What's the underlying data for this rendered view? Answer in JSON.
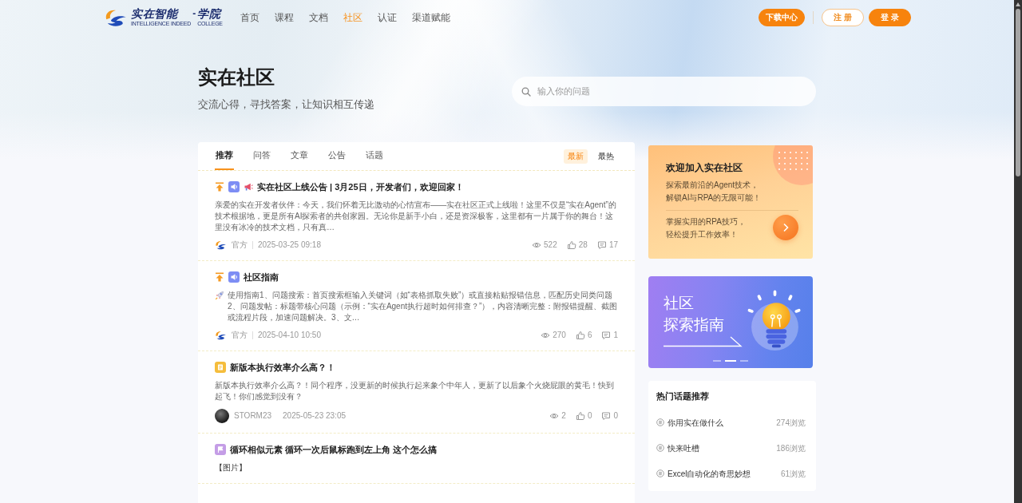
{
  "header": {
    "logo": {
      "name": "实在智能",
      "separator": "-",
      "suffix": "学院",
      "tagline": "INTELLIGENCE INDEED",
      "suffix_tagline": "COLLEGE"
    },
    "nav": [
      {
        "label": "首页",
        "selected": false
      },
      {
        "label": "课程",
        "selected": false
      },
      {
        "label": "文档",
        "selected": false
      },
      {
        "label": "社区",
        "selected": true
      },
      {
        "label": "认证",
        "selected": false
      },
      {
        "label": "渠道赋能",
        "selected": false
      }
    ],
    "buttons": [
      {
        "label": "下载中心",
        "kind": "filled"
      },
      {
        "label": "注册",
        "kind": "outline"
      },
      {
        "label": "登录",
        "kind": "filled"
      }
    ]
  },
  "hero": {
    "title": "实在社区",
    "subtitle": "交流心得，寻找答案，让知识相互传递",
    "search": {
      "placeholder": "输入你的问题"
    }
  },
  "feed": {
    "tabs": [
      {
        "label": "推荐",
        "selected": true
      },
      {
        "label": "问答",
        "selected": false
      },
      {
        "label": "文章",
        "selected": false
      },
      {
        "label": "公告",
        "selected": false
      },
      {
        "label": "话题",
        "selected": false
      }
    ],
    "sort": [
      {
        "label": "最新",
        "selected": true
      },
      {
        "label": "最热",
        "selected": false
      }
    ],
    "posts": [
      {
        "pinned": true,
        "kind": "announcement",
        "title_prefix": {
          "kind": "megaphone"
        },
        "title": "实在社区上线公告 | 3月25日，开发者们，欢迎回家！",
        "body": "亲爱的实在开发者伙伴：今天，我们怀着无比激动的心情宣布——实在社区正式上线啦！这里不仅是“实在Agent”的技术根据地，更是所有AI探索者的共创家园。无论你是新手小白，还是资深极客，这里都有一片属于你的舞台！这里没有冰冷的技术文档，只有真…",
        "author": {
          "kind": "official",
          "name": "官方"
        },
        "date": "2025-03-25 09:18",
        "views": "522",
        "likes": "28",
        "comments": "17"
      },
      {
        "pinned": true,
        "kind": "announcement",
        "title": "社区指南",
        "body_prefix": {
          "kind": "rocket"
        },
        "body": "使用指南1、问题搜索：首页搜索框输入关键词（如“表格抓取失败”）或直接粘贴报错信息，匹配历史同类问题2、问题发帖：标题带核心问题（示例：“实在Agent执行超时如何排查？”），内容清晰完整：附报错提醒、截图或流程片段，加速问题解决。3、文…",
        "author": {
          "kind": "official",
          "name": "官方"
        },
        "date": "2025-04-10 10:50",
        "views": "270",
        "likes": "6",
        "comments": "1"
      },
      {
        "pinned": false,
        "kind": "article",
        "title": "新版本执行效率介么高？！",
        "body": "新版本执行效率介么高？！同个程序，没更新的时候执行起来象个中年人，更新了以后象个火烧屁眼的黄毛！快到起飞！你们感觉到没有？",
        "author": {
          "kind": "user",
          "name": "STORM23"
        },
        "date": "2025-05-23 23:05",
        "views": "2",
        "likes": "0",
        "comments": "0"
      },
      {
        "pinned": false,
        "kind": "question",
        "title": "循环相似元素 循环一次后鼠标跑到左上角 这个怎么搞",
        "body": "【图片】"
      }
    ]
  },
  "sidebar": {
    "promo": {
      "title": "欢迎加入实在社区",
      "intro": [
        "探索最前沿的Agent技术，",
        "解锁AI与RPA的无限可能！"
      ],
      "outro": [
        "掌握实用的RPA技巧，",
        "轻松提升工作效率！"
      ]
    },
    "banner": {
      "title_lines": [
        "社区",
        "探索指南"
      ],
      "slides": [
        {
          "selected": false
        },
        {
          "selected": true
        },
        {
          "selected": false
        }
      ]
    },
    "hot_topics": {
      "title": "热门话题推荐",
      "items": [
        {
          "title": "你用实在做什么",
          "views": "274浏览"
        },
        {
          "title": "快来吐槽",
          "views": "186浏览"
        },
        {
          "title": "Excel自动化的奇思妙想",
          "views": "61浏览"
        }
      ]
    }
  }
}
